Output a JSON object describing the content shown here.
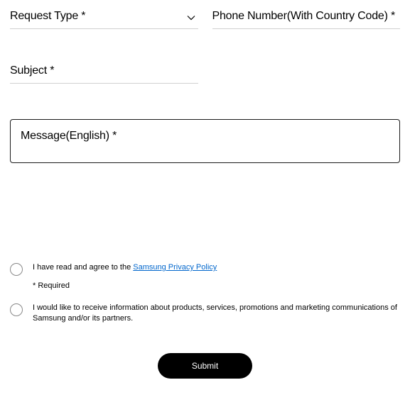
{
  "fields": {
    "request_type": {
      "label": "Request Type *"
    },
    "phone": {
      "label": "Phone Number(With Country Code) *"
    },
    "subject": {
      "label": "Subject *"
    },
    "message": {
      "label": "Message(English) *"
    }
  },
  "checkboxes": {
    "privacy": {
      "prefix": "I have read and agree to the ",
      "link_text": "Samsung Privacy Policy"
    },
    "required_note": "* Required",
    "marketing": {
      "text": "I would like to receive information about products, services, promotions and marketing communications of Samsung and/or its partners."
    }
  },
  "submit_label": "Submit"
}
